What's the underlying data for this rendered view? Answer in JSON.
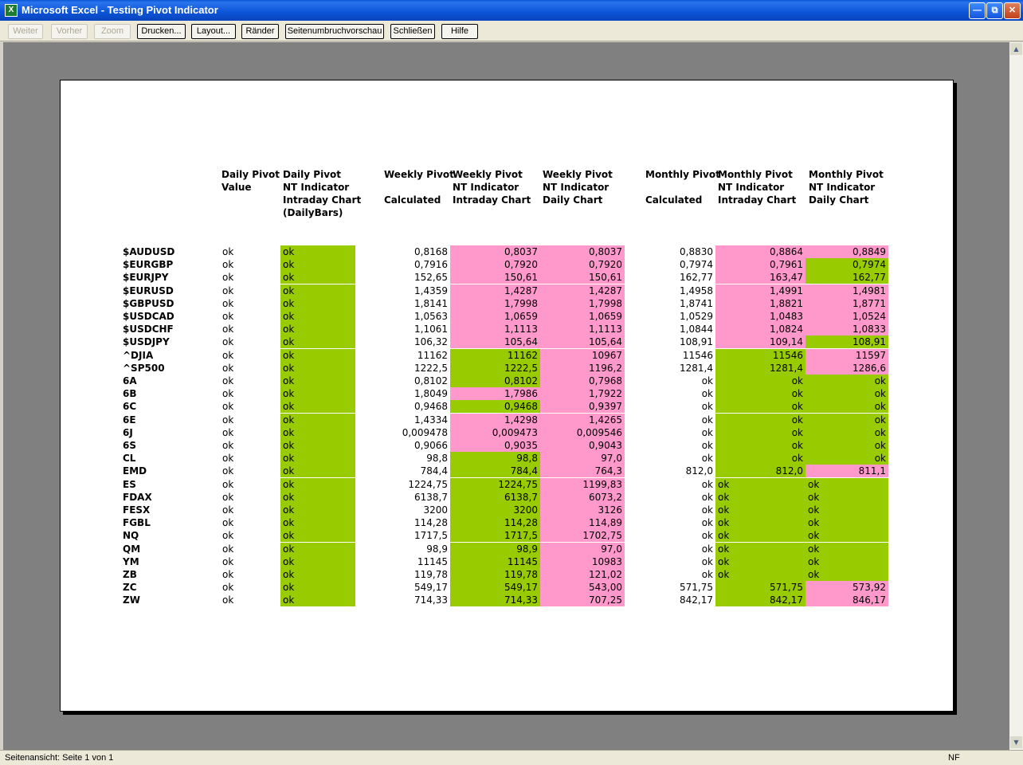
{
  "window": {
    "title": "Microsoft Excel - Testing Pivot Indicator"
  },
  "toolbar": {
    "buttons": [
      {
        "label": "Weiter",
        "enabled": false
      },
      {
        "label": "Vorher",
        "enabled": false
      },
      {
        "label": "Zoom",
        "enabled": false
      },
      {
        "label": "Drucken...",
        "enabled": true
      },
      {
        "label": "Layout...",
        "enabled": true
      },
      {
        "label": "Ränder",
        "enabled": true
      },
      {
        "label": "Seitenumbruchvorschau",
        "enabled": true
      },
      {
        "label": "Schließen",
        "enabled": true
      },
      {
        "label": "Hilfe",
        "enabled": true
      }
    ]
  },
  "colors": {
    "green": "#99cc00",
    "pink": "#ff99cc"
  },
  "headers": [
    "Daily Pivot\nValue",
    "Daily Pivot\nNT Indicator\nIntraday Chart\n(DailyBars)",
    "Weekly Pivot\n\nCalculated",
    "Weekly Pivot\nNT Indicator\nIntraday Chart",
    "Weekly Pivot\nNT Indicator\nDaily Chart",
    "Monthly Pivot\n\nCalculated",
    "Monthly Pivot\nNT Indicator\nIntraday Chart",
    "Monthly Pivot\nNT Indicator\nDaily Chart"
  ],
  "rows": [
    {
      "symbol": "$AUDUSD",
      "daily": "ok",
      "daily_nt": "ok",
      "w_calc": "0,8168",
      "w_intra": "0,8037",
      "w_intra_c": "p",
      "w_daily": "0,8037",
      "w_daily_c": "p",
      "m_calc": "0,8830",
      "m_intra": "0,8864",
      "m_intra_c": "p",
      "m_daily": "0,8849",
      "m_daily_c": "p"
    },
    {
      "symbol": "$EURGBP",
      "daily": "ok",
      "daily_nt": "ok",
      "w_calc": "0,7916",
      "w_intra": "0,7920",
      "w_intra_c": "p",
      "w_daily": "0,7920",
      "w_daily_c": "p",
      "m_calc": "0,7974",
      "m_intra": "0,7961",
      "m_intra_c": "p",
      "m_daily": "0,7974",
      "m_daily_c": "g"
    },
    {
      "symbol": "$EURJPY",
      "daily": "ok",
      "daily_nt": "ok",
      "w_calc": "152,65",
      "w_intra": "150,61",
      "w_intra_c": "p",
      "w_daily": "150,61",
      "w_daily_c": "p",
      "m_calc": "162,77",
      "m_intra": "163,47",
      "m_intra_c": "p",
      "m_daily": "162,77",
      "m_daily_c": "g"
    },
    {
      "symbol": "$EURUSD",
      "daily": "ok",
      "daily_nt": "ok",
      "w_calc": "1,4359",
      "w_intra": "1,4287",
      "w_intra_c": "p",
      "w_daily": "1,4287",
      "w_daily_c": "p",
      "m_calc": "1,4958",
      "m_intra": "1,4991",
      "m_intra_c": "p",
      "m_daily": "1,4981",
      "m_daily_c": "p"
    },
    {
      "symbol": "$GBPUSD",
      "daily": "ok",
      "daily_nt": "ok",
      "w_calc": "1,8141",
      "w_intra": "1,7998",
      "w_intra_c": "p",
      "w_daily": "1,7998",
      "w_daily_c": "p",
      "m_calc": "1,8741",
      "m_intra": "1,8821",
      "m_intra_c": "p",
      "m_daily": "1,8771",
      "m_daily_c": "p"
    },
    {
      "symbol": "$USDCAD",
      "daily": "ok",
      "daily_nt": "ok",
      "w_calc": "1,0563",
      "w_intra": "1,0659",
      "w_intra_c": "p",
      "w_daily": "1,0659",
      "w_daily_c": "p",
      "m_calc": "1,0529",
      "m_intra": "1,0483",
      "m_intra_c": "p",
      "m_daily": "1,0524",
      "m_daily_c": "p"
    },
    {
      "symbol": "$USDCHF",
      "daily": "ok",
      "daily_nt": "ok",
      "w_calc": "1,1061",
      "w_intra": "1,1113",
      "w_intra_c": "p",
      "w_daily": "1,1113",
      "w_daily_c": "p",
      "m_calc": "1,0844",
      "m_intra": "1,0824",
      "m_intra_c": "p",
      "m_daily": "1,0833",
      "m_daily_c": "p"
    },
    {
      "symbol": "$USDJPY",
      "daily": "ok",
      "daily_nt": "ok",
      "w_calc": "106,32",
      "w_intra": "105,64",
      "w_intra_c": "p",
      "w_daily": "105,64",
      "w_daily_c": "p",
      "m_calc": "108,91",
      "m_intra": "109,14",
      "m_intra_c": "p",
      "m_daily": "108,91",
      "m_daily_c": "g"
    },
    {
      "symbol": "^DJIA",
      "daily": "ok",
      "daily_nt": "ok",
      "w_calc": "11162",
      "w_intra": "11162",
      "w_intra_c": "g",
      "w_daily": "10967",
      "w_daily_c": "p",
      "m_calc": "11546",
      "m_intra": "11546",
      "m_intra_c": "g",
      "m_daily": "11597",
      "m_daily_c": "p"
    },
    {
      "symbol": "^SP500",
      "daily": "ok",
      "daily_nt": "ok",
      "w_calc": "1222,5",
      "w_intra": "1222,5",
      "w_intra_c": "g",
      "w_daily": "1196,2",
      "w_daily_c": "p",
      "m_calc": "1281,4",
      "m_intra": "1281,4",
      "m_intra_c": "g",
      "m_daily": "1286,6",
      "m_daily_c": "p"
    },
    {
      "symbol": "6A",
      "daily": "ok",
      "daily_nt": "ok",
      "w_calc": "0,8102",
      "w_intra": "0,8102",
      "w_intra_c": "g",
      "w_daily": "0,7968",
      "w_daily_c": "p",
      "m_calc": "ok",
      "m_intra": "ok",
      "m_intra_c": "g",
      "m_daily": "ok",
      "m_daily_c": "g"
    },
    {
      "symbol": "6B",
      "daily": "ok",
      "daily_nt": "ok",
      "w_calc": "1,8049",
      "w_intra": "1,7986",
      "w_intra_c": "p",
      "w_daily": "1,7922",
      "w_daily_c": "p",
      "m_calc": "ok",
      "m_intra": "ok",
      "m_intra_c": "g",
      "m_daily": "ok",
      "m_daily_c": "g"
    },
    {
      "symbol": "6C",
      "daily": "ok",
      "daily_nt": "ok",
      "w_calc": "0,9468",
      "w_intra": "0,9468",
      "w_intra_c": "g",
      "w_daily": "0,9397",
      "w_daily_c": "p",
      "m_calc": "ok",
      "m_intra": "ok",
      "m_intra_c": "g",
      "m_daily": "ok",
      "m_daily_c": "g"
    },
    {
      "symbol": "6E",
      "daily": "ok",
      "daily_nt": "ok",
      "w_calc": "1,4334",
      "w_intra": "1,4298",
      "w_intra_c": "p",
      "w_daily": "1,4265",
      "w_daily_c": "p",
      "m_calc": "ok",
      "m_intra": "ok",
      "m_intra_c": "g",
      "m_daily": "ok",
      "m_daily_c": "g"
    },
    {
      "symbol": "6J",
      "daily": "ok",
      "daily_nt": "ok",
      "w_calc": "0,009478",
      "w_intra": "0,009473",
      "w_intra_c": "p",
      "w_daily": "0,009546",
      "w_daily_c": "p",
      "m_calc": "ok",
      "m_intra": "ok",
      "m_intra_c": "g",
      "m_daily": "ok",
      "m_daily_c": "g"
    },
    {
      "symbol": "6S",
      "daily": "ok",
      "daily_nt": "ok",
      "w_calc": "0,9066",
      "w_intra": "0,9035",
      "w_intra_c": "p",
      "w_daily": "0,9043",
      "w_daily_c": "p",
      "m_calc": "ok",
      "m_intra": "ok",
      "m_intra_c": "g",
      "m_daily": "ok",
      "m_daily_c": "g"
    },
    {
      "symbol": "CL",
      "daily": "ok",
      "daily_nt": "ok",
      "w_calc": "98,8",
      "w_intra": "98,8",
      "w_intra_c": "g",
      "w_daily": "97,0",
      "w_daily_c": "p",
      "m_calc": "ok",
      "m_intra": "ok",
      "m_intra_c": "g",
      "m_daily": "ok",
      "m_daily_c": "g"
    },
    {
      "symbol": "EMD",
      "daily": "ok",
      "daily_nt": "ok",
      "w_calc": "784,4",
      "w_intra": "784,4",
      "w_intra_c": "g",
      "w_daily": "764,3",
      "w_daily_c": "p",
      "m_calc": "812,0",
      "m_intra": "812,0",
      "m_intra_c": "g",
      "m_daily": "811,1",
      "m_daily_c": "p"
    },
    {
      "symbol": "ES",
      "daily": "ok",
      "daily_nt": "ok",
      "w_calc": "1224,75",
      "w_intra": "1224,75",
      "w_intra_c": "g",
      "w_daily": "1199,83",
      "w_daily_c": "p",
      "m_calc": "ok",
      "m_intra": "ok",
      "m_intra_c": "gl",
      "m_daily": "ok",
      "m_daily_c": "gl"
    },
    {
      "symbol": "FDAX",
      "daily": "ok",
      "daily_nt": "ok",
      "w_calc": "6138,7",
      "w_intra": "6138,7",
      "w_intra_c": "g",
      "w_daily": "6073,2",
      "w_daily_c": "p",
      "m_calc": "ok",
      "m_intra": "ok",
      "m_intra_c": "gl",
      "m_daily": "ok",
      "m_daily_c": "gl"
    },
    {
      "symbol": "FESX",
      "daily": "ok",
      "daily_nt": "ok",
      "w_calc": "3200",
      "w_intra": "3200",
      "w_intra_c": "g",
      "w_daily": "3126",
      "w_daily_c": "p",
      "m_calc": "ok",
      "m_intra": "ok",
      "m_intra_c": "gl",
      "m_daily": "ok",
      "m_daily_c": "gl"
    },
    {
      "symbol": "FGBL",
      "daily": "ok",
      "daily_nt": "ok",
      "w_calc": "114,28",
      "w_intra": "114,28",
      "w_intra_c": "g",
      "w_daily": "114,89",
      "w_daily_c": "p",
      "m_calc": "ok",
      "m_intra": "ok",
      "m_intra_c": "gl",
      "m_daily": "ok",
      "m_daily_c": "gl"
    },
    {
      "symbol": "NQ",
      "daily": "ok",
      "daily_nt": "ok",
      "w_calc": "1717,5",
      "w_intra": "1717,5",
      "w_intra_c": "g",
      "w_daily": "1702,75",
      "w_daily_c": "p",
      "m_calc": "ok",
      "m_intra": "ok",
      "m_intra_c": "gl",
      "m_daily": "ok",
      "m_daily_c": "gl"
    },
    {
      "symbol": "QM",
      "daily": "ok",
      "daily_nt": "ok",
      "w_calc": "98,9",
      "w_intra": "98,9",
      "w_intra_c": "g",
      "w_daily": "97,0",
      "w_daily_c": "p",
      "m_calc": "ok",
      "m_intra": "ok",
      "m_intra_c": "gl",
      "m_daily": "ok",
      "m_daily_c": "gl"
    },
    {
      "symbol": "YM",
      "daily": "ok",
      "daily_nt": "ok",
      "w_calc": "11145",
      "w_intra": "11145",
      "w_intra_c": "g",
      "w_daily": "10983",
      "w_daily_c": "p",
      "m_calc": "ok",
      "m_intra": "ok",
      "m_intra_c": "gl",
      "m_daily": "ok",
      "m_daily_c": "gl"
    },
    {
      "symbol": "ZB",
      "daily": "ok",
      "daily_nt": "ok",
      "w_calc": "119,78",
      "w_intra": "119,78",
      "w_intra_c": "g",
      "w_daily": "121,02",
      "w_daily_c": "p",
      "m_calc": "ok",
      "m_intra": "ok",
      "m_intra_c": "gl",
      "m_daily": "ok",
      "m_daily_c": "gl"
    },
    {
      "symbol": "ZC",
      "daily": "ok",
      "daily_nt": "ok",
      "w_calc": "549,17",
      "w_intra": "549,17",
      "w_intra_c": "g",
      "w_daily": "543,00",
      "w_daily_c": "p",
      "m_calc": "571,75",
      "m_intra": "571,75",
      "m_intra_c": "g",
      "m_daily": "573,92",
      "m_daily_c": "p"
    },
    {
      "symbol": "ZW",
      "daily": "ok",
      "daily_nt": "ok",
      "w_calc": "714,33",
      "w_intra": "714,33",
      "w_intra_c": "g",
      "w_daily": "707,25",
      "w_daily_c": "p",
      "m_calc": "842,17",
      "m_intra": "842,17",
      "m_intra_c": "g",
      "m_daily": "846,17",
      "m_daily_c": "p"
    }
  ],
  "status": {
    "left": "Seitenansicht: Seite 1 von 1",
    "right": "NF"
  }
}
